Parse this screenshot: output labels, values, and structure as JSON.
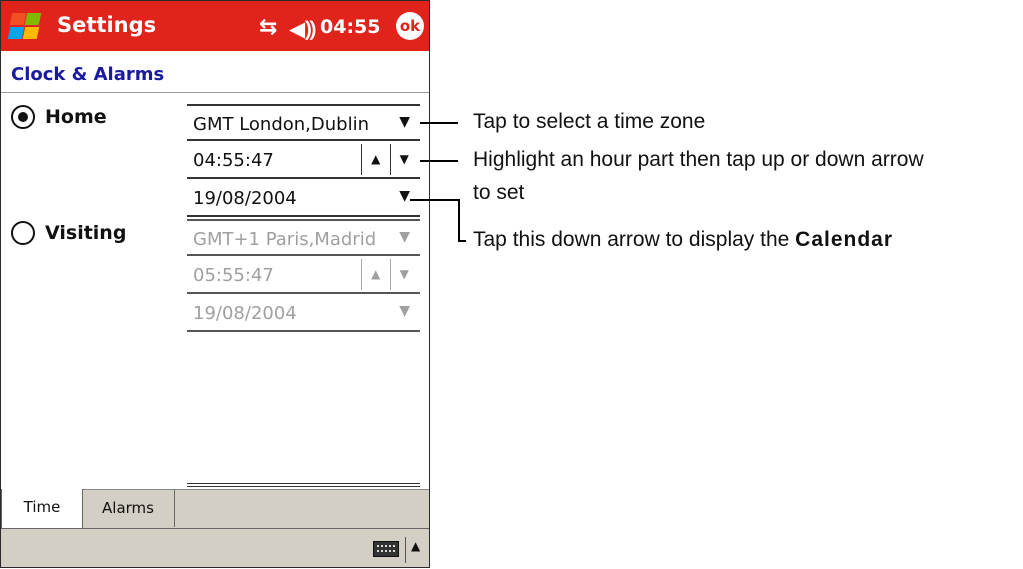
{
  "titlebar": {
    "app_title": "Settings",
    "time": "04:55",
    "ok_label": "ok",
    "icons": [
      "windows-logo",
      "connectivity-icon",
      "volume-icon"
    ]
  },
  "page": {
    "title": "Clock & Alarms"
  },
  "home": {
    "label": "Home",
    "selected": true,
    "timezone": "GMT London,Dublin",
    "time": "04:55:47",
    "date": "19/08/2004"
  },
  "visiting": {
    "label": "Visiting",
    "selected": false,
    "timezone": "GMT+1 Paris,Madrid",
    "time": "05:55:47",
    "date": "19/08/2004"
  },
  "tabs": [
    {
      "label": "Time",
      "active": true
    },
    {
      "label": "Alarms",
      "active": false
    }
  ],
  "callouts": {
    "timezone": "Tap to select a time zone",
    "time_line1": "Highlight an hour part then tap up or down arrow",
    "time_line2": "to set",
    "calendar_prefix": "Tap this down arrow to display the ",
    "calendar_bold": "Calendar"
  },
  "colors": {
    "titlebar": "#e0231b",
    "page_title": "#1a1aa0",
    "bars": "#d4cfc4"
  }
}
